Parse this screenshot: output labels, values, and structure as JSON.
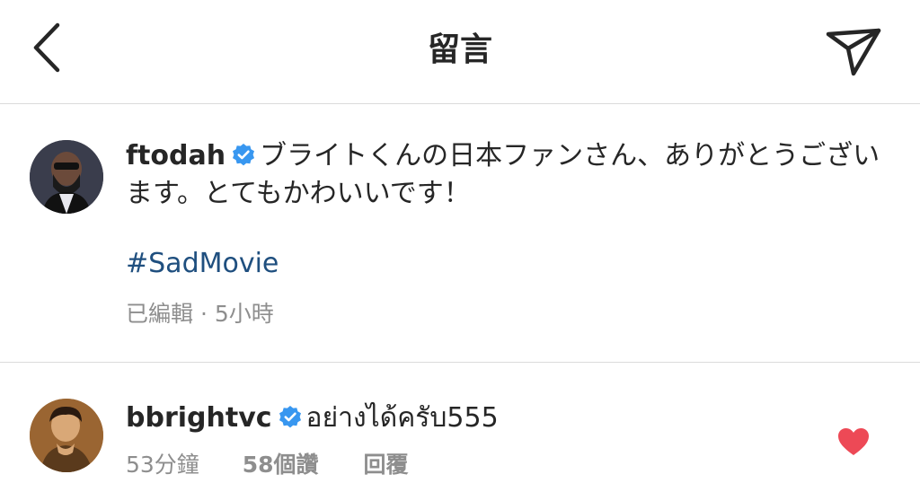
{
  "header": {
    "title": "留言"
  },
  "caption": {
    "username": "ftodah",
    "text": "ブライトくんの日本ファンさん、ありがとうございます。とてもかわいいです！",
    "hashtag": "#SadMovie",
    "meta": "已編輯 · 5小時"
  },
  "comment": {
    "username": "bbrightvc",
    "text": "อย่างได้ครับ555",
    "time": "53分鐘",
    "likes": "58個讚",
    "reply": "回覆"
  },
  "colors": {
    "verified": "#3897f0",
    "heart": "#ed4956",
    "hashtag": "#1f4f7f",
    "meta": "#8e8e8e"
  }
}
